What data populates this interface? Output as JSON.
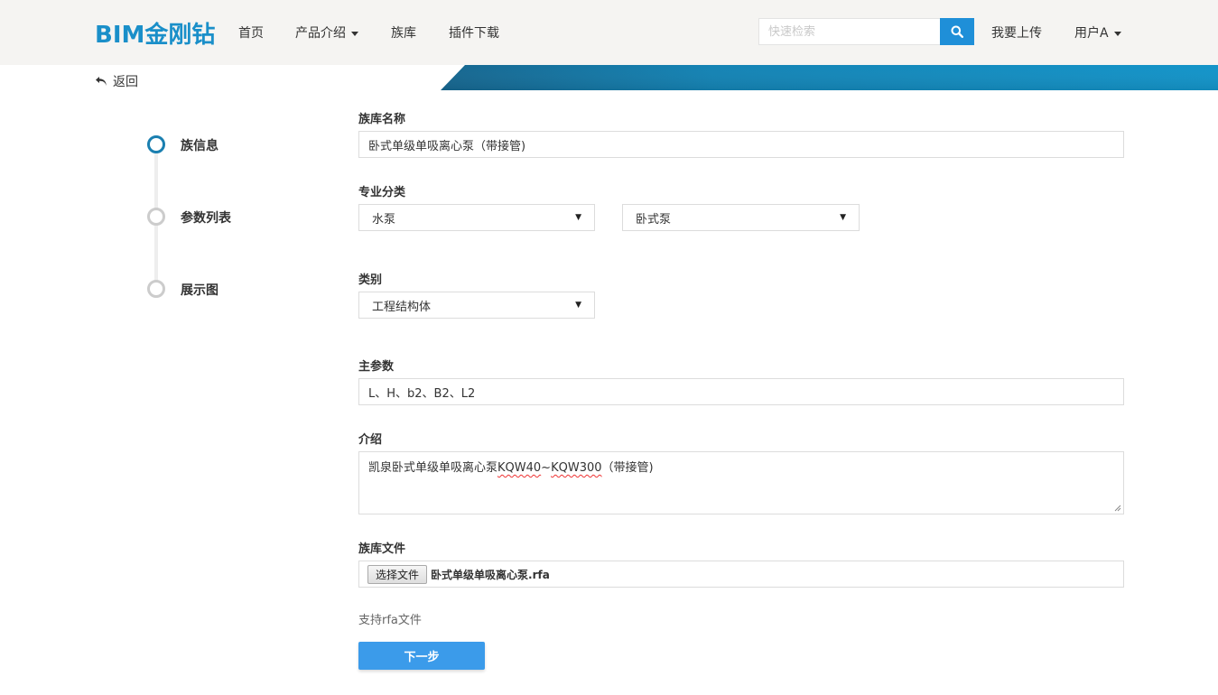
{
  "nav": {
    "brand": "BIM金刚钻",
    "items": [
      {
        "label": "首页"
      },
      {
        "label": "产品介绍"
      },
      {
        "label": "族库"
      },
      {
        "label": "插件下载"
      }
    ],
    "search_placeholder": "快速检索",
    "upload_label": "我要上传",
    "user_label": "用户A"
  },
  "back_label": "返回",
  "steps": [
    {
      "label": "族信息",
      "active": true
    },
    {
      "label": "参数列表",
      "active": false
    },
    {
      "label": "展示图",
      "active": false
    }
  ],
  "form": {
    "name_label": "族库名称",
    "name_value": "卧式单级单吸离心泵（带接管)",
    "discipline_label": "专业分类",
    "discipline_select_1": "水泵",
    "discipline_select_2": "卧式泵",
    "category_label": "类别",
    "category_select": "工程结构体",
    "main_params_label": "主参数",
    "main_params_value": "L、H、b2、B2、L2",
    "intro_label": "介绍",
    "intro_prefix": "凯泉卧式单级单吸离心泵",
    "intro_code1": "KQW40",
    "intro_sep": "~",
    "intro_code2": "KQW300",
    "intro_suffix": "（带接管)",
    "file_label": "族库文件",
    "file_button": "选择文件",
    "file_name": "卧式单级单吸离心泵.rfa",
    "hint": "支持rfa文件",
    "next_button": "下一步"
  },
  "colors": {
    "brand": "#1a8fc9",
    "accent_blue": "#1f8fd8",
    "step_active": "#1a7fb0",
    "step_inactive": "#cccccc",
    "button": "#3b9bea"
  }
}
